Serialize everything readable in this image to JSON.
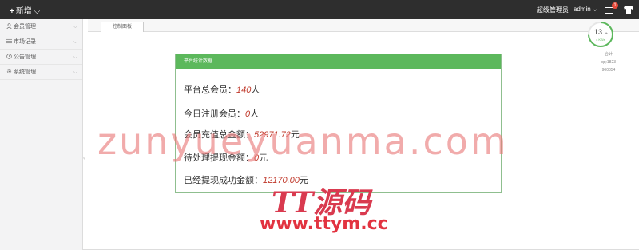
{
  "topbar": {
    "new_label": "新增",
    "role": "超级管理员",
    "username": "admin",
    "message_count": "1"
  },
  "sidebar": {
    "items": [
      {
        "label": "会员管理",
        "icon": "user-icon"
      },
      {
        "label": "市场记录",
        "icon": "list-icon"
      },
      {
        "label": "公告管理",
        "icon": "notice-icon"
      },
      {
        "label": "系统管理",
        "icon": "gear-icon"
      }
    ]
  },
  "tabs": [
    {
      "label": "控制面板"
    }
  ],
  "panel": {
    "title": "平台统计数据",
    "rows": [
      {
        "label": "平台总会员：",
        "value": "140",
        "unit": "人"
      },
      {
        "label": "今日注册会员：",
        "value": "0",
        "unit": "人"
      },
      {
        "label": "会员充值总金额：",
        "value": "52971.72",
        "unit": "元"
      },
      {
        "label": "待处理提现金额：",
        "value": "0",
        "unit": "元"
      },
      {
        "label": "已经提现成功金额：",
        "value": "12170.00",
        "unit": "元"
      }
    ]
  },
  "widget": {
    "percent": "13",
    "percent_sign": "%",
    "sub": "4 KB/s",
    "lines": [
      "合计",
      "qq:1823",
      "900854"
    ]
  },
  "watermark": {
    "main": "zunyueyuanma.com",
    "logo": "TT源码",
    "url": "www.ttym.cc"
  },
  "colors": {
    "topbar": "#2e2e2e",
    "panel_header": "#5cb85c",
    "value_text": "#c0392b",
    "watermark": "#e97878"
  }
}
